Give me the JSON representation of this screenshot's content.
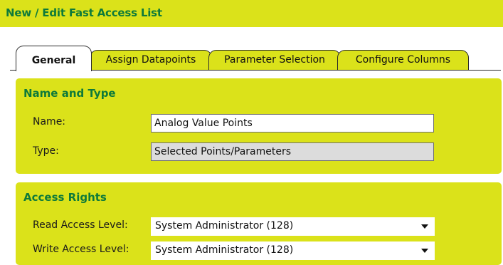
{
  "header": {
    "title": "New / Edit Fast Access List"
  },
  "tabs": [
    {
      "label": "General"
    },
    {
      "label": "Assign Datapoints"
    },
    {
      "label": "Parameter Selection"
    },
    {
      "label": "Configure Columns"
    }
  ],
  "name_type": {
    "title": "Name and Type",
    "name_label": "Name:",
    "name_value": "Analog Value Points",
    "type_label": "Type:",
    "type_value": "Selected Points/Parameters"
  },
  "access": {
    "title": "Access Rights",
    "read_label": "Read Access Level:",
    "read_value": "System Administrator (128)",
    "write_label": "Write Access Level:",
    "write_value": "System Administrator (128)"
  },
  "colors": {
    "accent": "#dbe21a",
    "title_text": "#0e7a3a"
  },
  "icons": {
    "dropdown": "chevron-down-icon"
  }
}
